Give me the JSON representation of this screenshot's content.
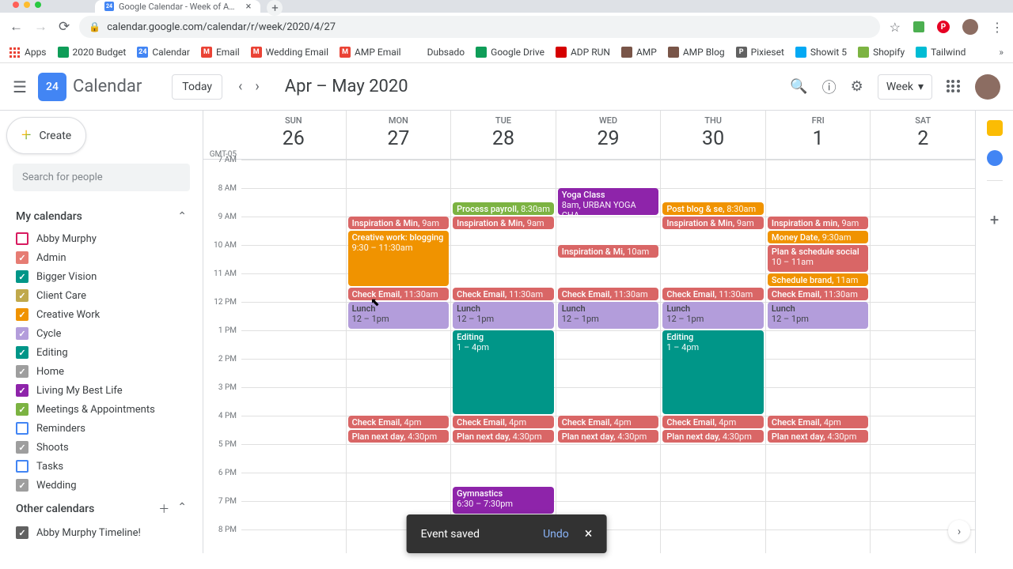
{
  "browser": {
    "tab_title": "Google Calendar - Week of A…",
    "tab_favicon": "24",
    "url": "calendar.google.com/calendar/r/week/2020/4/27",
    "bookmarks": [
      {
        "label": "Apps",
        "icon_bg": "#f1f3f4",
        "icon_txt": ""
      },
      {
        "label": "2020 Budget",
        "icon_bg": "#0f9d58",
        "icon_txt": ""
      },
      {
        "label": "Calendar",
        "icon_bg": "#4285f4",
        "icon_txt": "24"
      },
      {
        "label": "Email",
        "icon_bg": "#ea4335",
        "icon_txt": "M"
      },
      {
        "label": "Wedding Email",
        "icon_bg": "#ea4335",
        "icon_txt": "M"
      },
      {
        "label": "AMP Email",
        "icon_bg": "#ea4335",
        "icon_txt": "M"
      },
      {
        "label": "Dubsado",
        "icon_bg": "#fff",
        "icon_txt": ""
      },
      {
        "label": "Google Drive",
        "icon_bg": "#0f9d58",
        "icon_txt": ""
      },
      {
        "label": "ADP RUN",
        "icon_bg": "#d50000",
        "icon_txt": ""
      },
      {
        "label": "AMP",
        "icon_bg": "#795548",
        "icon_txt": ""
      },
      {
        "label": "AMP Blog",
        "icon_bg": "#795548",
        "icon_txt": ""
      },
      {
        "label": "Pixieset",
        "icon_bg": "#616161",
        "icon_txt": "P"
      },
      {
        "label": "Showit 5",
        "icon_bg": "#03a9f4",
        "icon_txt": ""
      },
      {
        "label": "Shopify",
        "icon_bg": "#7cb342",
        "icon_txt": ""
      },
      {
        "label": "Tailwind",
        "icon_bg": "#00bcd4",
        "icon_txt": ""
      }
    ]
  },
  "header": {
    "logo_text": "24",
    "app_name": "Calendar",
    "today": "Today",
    "date_range": "Apr – May 2020",
    "view": "Week"
  },
  "sidebar": {
    "create": "Create",
    "search_placeholder": "Search for people",
    "section1": "My calendars",
    "section2": "Other calendars",
    "calendars": [
      {
        "name": "Abby Murphy",
        "color": "#d81b60",
        "checked": false
      },
      {
        "name": "Admin",
        "color": "#e67c73",
        "checked": true
      },
      {
        "name": "Bigger Vision",
        "color": "#009688",
        "checked": true
      },
      {
        "name": "Client Care",
        "color": "#c0a94c",
        "checked": true
      },
      {
        "name": "Creative Work",
        "color": "#f09300",
        "checked": true
      },
      {
        "name": "Cycle",
        "color": "#b39ddb",
        "checked": true
      },
      {
        "name": "Editing",
        "color": "#009688",
        "checked": true
      },
      {
        "name": "Home",
        "color": "#9e9e9e",
        "checked": true
      },
      {
        "name": "Living My Best Life",
        "color": "#8e24aa",
        "checked": true
      },
      {
        "name": "Meetings & Appointments",
        "color": "#7cb342",
        "checked": true
      },
      {
        "name": "Reminders",
        "color": "#4285f4",
        "checked": false
      },
      {
        "name": "Shoots",
        "color": "#9e9e9e",
        "checked": true
      },
      {
        "name": "Tasks",
        "color": "#4285f4",
        "checked": false
      },
      {
        "name": "Wedding",
        "color": "#9e9e9e",
        "checked": true
      }
    ],
    "other_calendars": [
      {
        "name": "Abby Murphy Timeline!",
        "color": "#616161",
        "checked": true
      }
    ]
  },
  "week": {
    "tz": "GMT-05",
    "days": [
      {
        "label": "SUN",
        "num": "26"
      },
      {
        "label": "MON",
        "num": "27"
      },
      {
        "label": "TUE",
        "num": "28"
      },
      {
        "label": "WED",
        "num": "29"
      },
      {
        "label": "THU",
        "num": "30"
      },
      {
        "label": "FRI",
        "num": "1"
      },
      {
        "label": "SAT",
        "num": "2"
      }
    ],
    "hours": [
      "7 AM",
      "8 AM",
      "9 AM",
      "10 AM",
      "11 AM",
      "12 PM",
      "1 PM",
      "2 PM",
      "3 PM",
      "4 PM",
      "5 PM",
      "6 PM",
      "7 PM",
      "8 PM"
    ]
  },
  "events": {
    "mon": {
      "inspiration": {
        "title": "Inspiration & Min",
        "time": "9am"
      },
      "creative": {
        "title": "Creative work: blogging",
        "time": "9:30 – 11:30am"
      },
      "check_am": {
        "title": "Check Email,",
        "time": "11:30am"
      },
      "lunch": {
        "title": "Lunch",
        "time": "12 – 1pm"
      },
      "check_pm": {
        "title": "Check Email,",
        "time": "4pm"
      },
      "plan": {
        "title": "Plan next day,",
        "time": "4:30pm"
      }
    },
    "tue": {
      "process": {
        "title": "Process payroll",
        "time": "8:30am"
      },
      "inspiration": {
        "title": "Inspiration & Min",
        "time": "9am"
      },
      "check_am": {
        "title": "Check Email,",
        "time": "11:30am"
      },
      "lunch": {
        "title": "Lunch",
        "time": "12 – 1pm"
      },
      "editing": {
        "title": "Editing",
        "time": "1 – 4pm"
      },
      "check_pm": {
        "title": "Check Email,",
        "time": "4pm"
      },
      "plan": {
        "title": "Plan next day,",
        "time": "4:30pm"
      },
      "gym": {
        "title": "Gymnastics",
        "time": "6:30 – 7:30pm"
      }
    },
    "wed": {
      "yoga": {
        "title": "Yoga Class",
        "sub": "8am, URBAN YOGA CHA"
      },
      "inspiration": {
        "title": "Inspiration & Mi",
        "time": "10am"
      },
      "check_am": {
        "title": "Check Email,",
        "time": "11:30am"
      },
      "lunch": {
        "title": "Lunch",
        "time": "12 – 1pm"
      },
      "check_pm": {
        "title": "Check Email,",
        "time": "4pm"
      },
      "plan": {
        "title": "Plan next day,",
        "time": "4:30pm"
      }
    },
    "thu": {
      "post": {
        "title": "Post blog & se",
        "time": "8:30am"
      },
      "inspiration": {
        "title": "Inspiration & Min",
        "time": "9am"
      },
      "check_am": {
        "title": "Check Email,",
        "time": "11:30am"
      },
      "lunch": {
        "title": "Lunch",
        "time": "12 – 1pm"
      },
      "editing": {
        "title": "Editing",
        "time": "1 – 4pm"
      },
      "check_pm": {
        "title": "Check Email,",
        "time": "4pm"
      },
      "plan": {
        "title": "Plan next day,",
        "time": "4:30pm"
      }
    },
    "fri": {
      "inspiration": {
        "title": "Inspiration & min",
        "time": "9am"
      },
      "money": {
        "title": "Money Date,",
        "time": "9:30am"
      },
      "plan_social": {
        "title": "Plan & schedule social",
        "time": "10 – 11am"
      },
      "schedule": {
        "title": "Schedule brand",
        "time": "11am"
      },
      "check_am": {
        "title": "Check Email,",
        "time": "11:30am"
      },
      "lunch": {
        "title": "Lunch",
        "time": "12 – 1pm"
      },
      "check_pm": {
        "title": "Check Email,",
        "time": "4pm"
      },
      "plan": {
        "title": "Plan next day,",
        "time": "4:30pm"
      }
    }
  },
  "toast": {
    "msg": "Event saved",
    "undo": "Undo"
  }
}
